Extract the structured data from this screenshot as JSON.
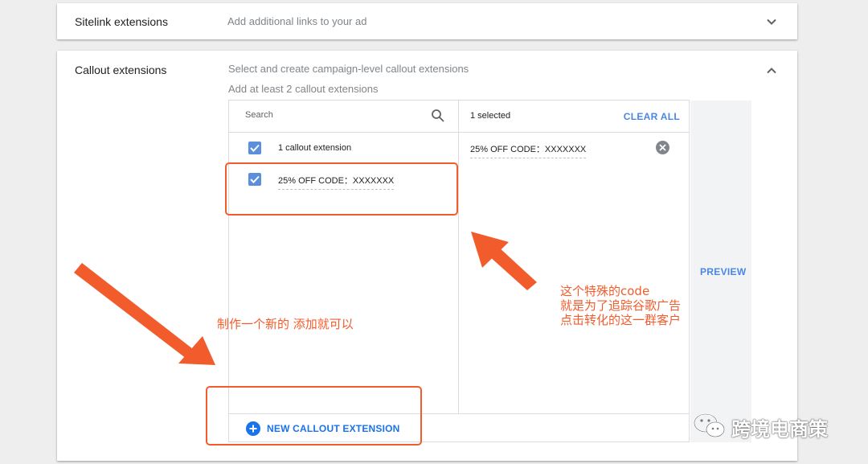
{
  "sitelink": {
    "title": "Sitelink extensions",
    "description": "Add additional links to your ad"
  },
  "callout": {
    "title": "Callout extensions",
    "description": "Select and create campaign-level callout extensions",
    "hint": "Add at least 2 callout extensions",
    "search_placeholder": "Search",
    "items": [
      {
        "label": "1 callout extension",
        "checked": true
      },
      {
        "label": "25% OFF CODE：XXXXXXX",
        "checked": true
      }
    ],
    "selected_count": "1 selected",
    "clear_all": "CLEAR ALL",
    "selected_items": [
      {
        "label": "25% OFF CODE：XXXXXXX"
      }
    ],
    "new_button": "NEW CALLOUT EXTENSION",
    "preview": "PREVIEW"
  },
  "annotations": {
    "left_note": "制作一个新的 添加就可以",
    "right_note": [
      "这个特殊的code",
      "就是为了追踪谷歌广告",
      "点击转化的这一群客户"
    ],
    "color": "#f25c2c"
  },
  "watermark": "跨境电商策",
  "colors": {
    "accent": "#1a73e8",
    "checkbox": "#5b8fdc",
    "annotation": "#f25c2c"
  }
}
